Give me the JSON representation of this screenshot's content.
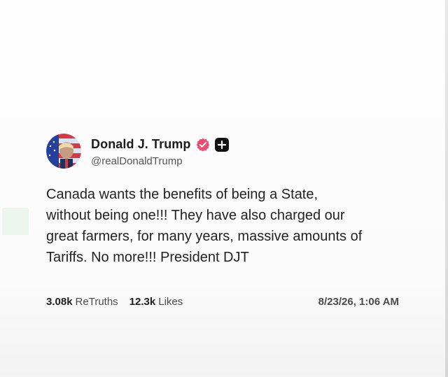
{
  "post": {
    "author": {
      "display_name": "Donald J. Trump",
      "handle": "@realDonaldTrump",
      "verified_icon": "verified-badge-icon",
      "plus_icon": "plus-badge-icon",
      "avatar_icon": "profile-avatar"
    },
    "text": "Canada wants the benefits of being a State,\nwithout being one!!! They have also charged our\ngreat farmers, for many years, massive amounts of\nTariffs. No more!!! President DJT",
    "stats": {
      "retruths_count": "3.08k",
      "retruths_label": "ReTruths",
      "likes_count": "12.3k",
      "likes_label": "Likes"
    },
    "timestamp": "8/23/26, 1:06 AM"
  },
  "colors": {
    "verified_badge": "#f04b70",
    "plus_badge": "#111111",
    "text_primary": "#1f1f1f",
    "text_secondary": "#555555"
  }
}
